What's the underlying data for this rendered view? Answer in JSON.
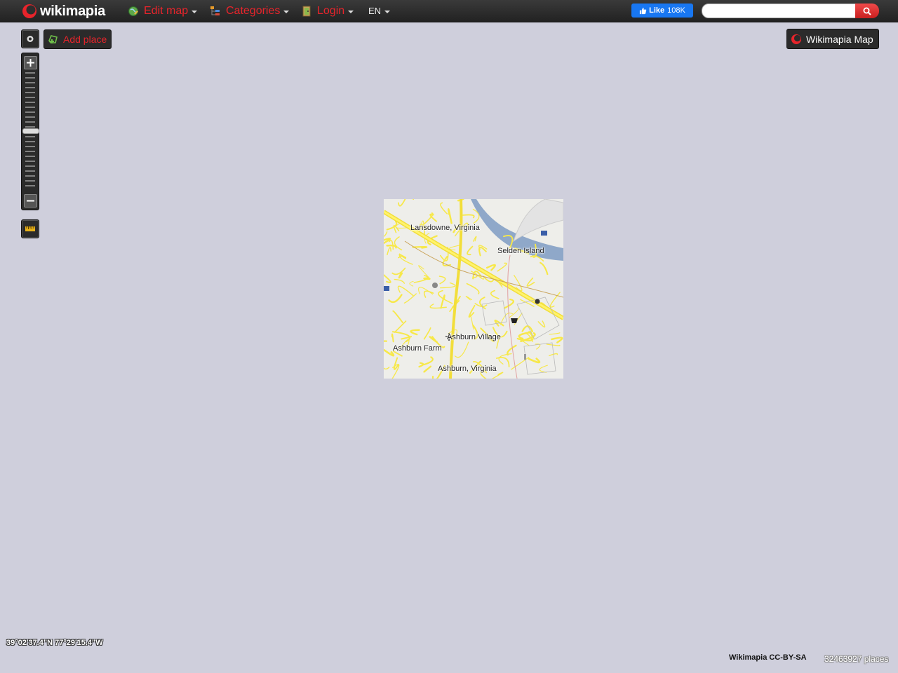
{
  "header": {
    "logo_text": "wikimapia",
    "menu": [
      {
        "label": "Edit map",
        "icon": "globe-pencil-icon"
      },
      {
        "label": "Categories",
        "icon": "tree-icon"
      },
      {
        "label": "Login",
        "icon": "door-icon"
      }
    ],
    "language": "EN",
    "fb_like_label": "Like",
    "fb_like_count": "108K",
    "search": {
      "value": "",
      "placeholder": ""
    }
  },
  "controls": {
    "add_place_label": "Add place",
    "map_type_label": "Wikimapia Map",
    "zoom_level_fraction": 0.5
  },
  "map": {
    "labels": [
      "Lansdowne, Virginia",
      "Selden Island",
      "Ashburn Village",
      "Ashburn Farm",
      "Ashburn, Virginia"
    ]
  },
  "footer": {
    "coordinates": "39°02'37.4\"N 77°29'15.4\"W",
    "license": "Wikimapia CC-BY-SA",
    "places_count": "32463927 places"
  },
  "colors": {
    "accent": "#e8242b",
    "topbar": "#2b2b2b",
    "background": "#cfcfdc",
    "road": "#f7e84a",
    "river": "#8fa8c9"
  }
}
